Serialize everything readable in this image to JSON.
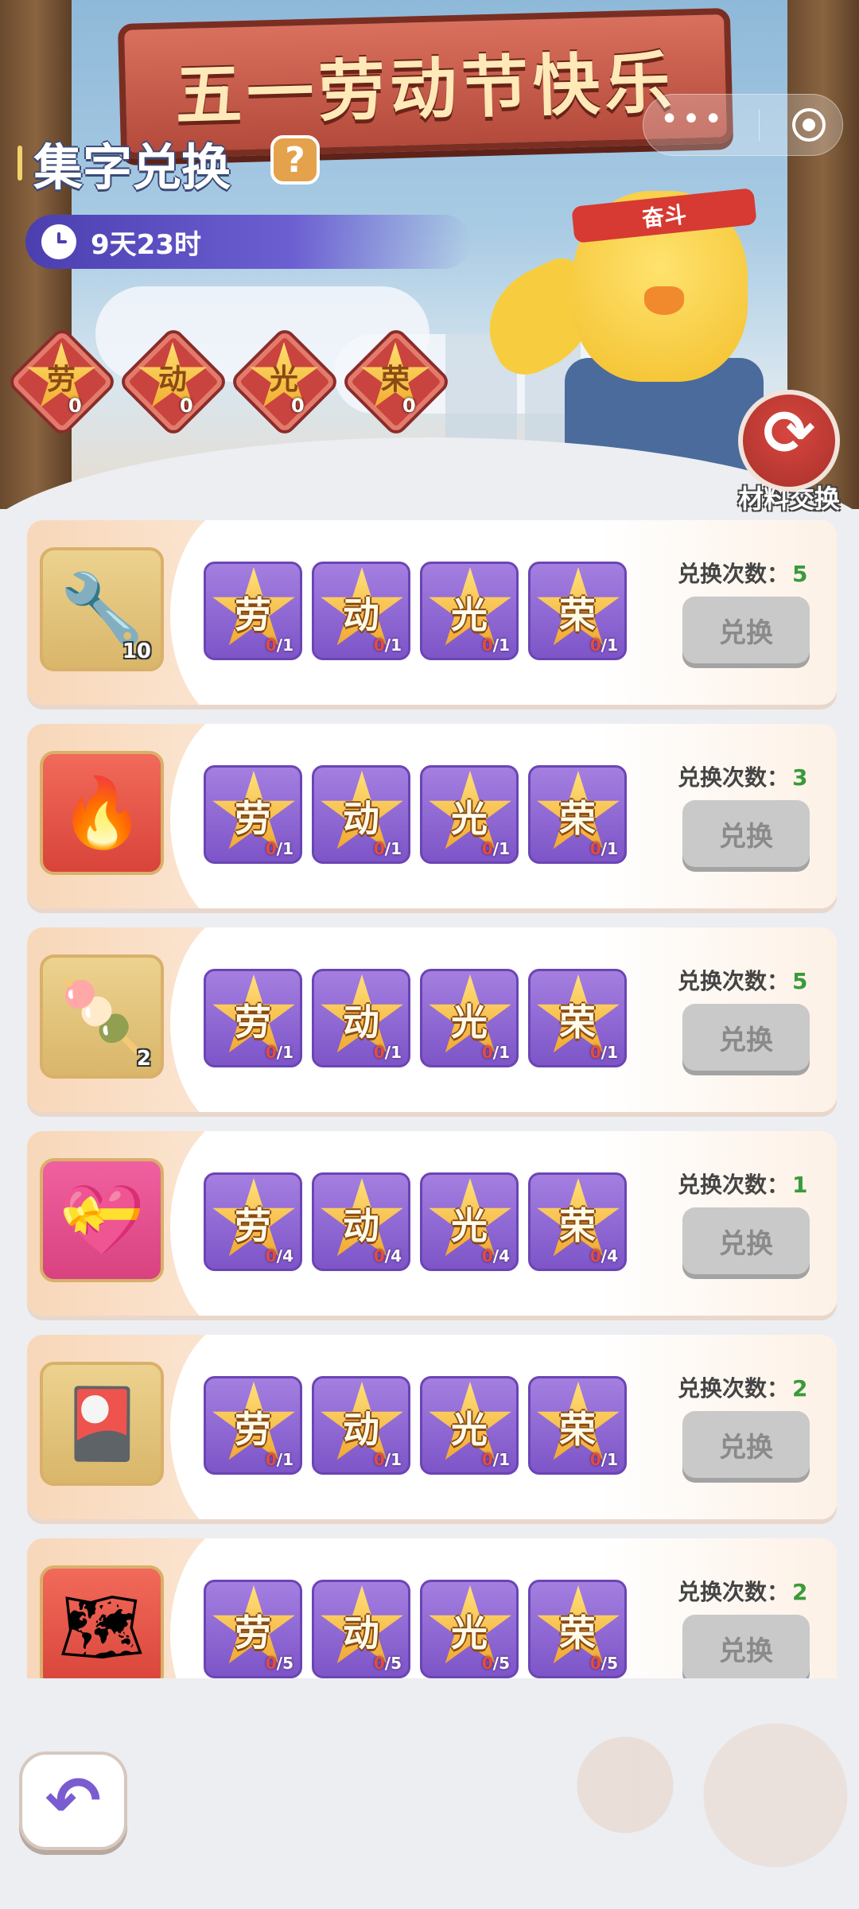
{
  "banner": {
    "sign_text": "五一劳动节快乐",
    "headband_text": "奋斗"
  },
  "header": {
    "title": "集字兑换",
    "help_label": "?",
    "timer": "9天23时",
    "material_exchange_label": "材料交换"
  },
  "collected_chars": [
    {
      "char": "劳",
      "count": "0"
    },
    {
      "char": "动",
      "count": "0"
    },
    {
      "char": "光",
      "count": "0"
    },
    {
      "char": "荣",
      "count": "0"
    }
  ],
  "exchange_items": [
    {
      "reward_icon": "wrench-icon",
      "reward_glyph": "🔧",
      "reward_qty": "10",
      "costs": [
        {
          "char": "劳",
          "have": "0",
          "need": "1"
        },
        {
          "char": "动",
          "have": "0",
          "need": "1"
        },
        {
          "char": "光",
          "have": "0",
          "need": "1"
        },
        {
          "char": "荣",
          "have": "0",
          "need": "1"
        }
      ],
      "times_label": "兑换次数：",
      "times": "5",
      "button": "兑换"
    },
    {
      "reward_icon": "fireball-icon",
      "reward_glyph": "🔥",
      "reward_qty": "",
      "costs": [
        {
          "char": "劳",
          "have": "0",
          "need": "1"
        },
        {
          "char": "动",
          "have": "0",
          "need": "1"
        },
        {
          "char": "光",
          "have": "0",
          "need": "1"
        },
        {
          "char": "荣",
          "have": "0",
          "need": "1"
        }
      ],
      "times_label": "兑换次数：",
      "times": "3",
      "button": "兑换"
    },
    {
      "reward_icon": "popsicle-icon",
      "reward_glyph": "🍡",
      "reward_qty": "2",
      "costs": [
        {
          "char": "劳",
          "have": "0",
          "need": "1"
        },
        {
          "char": "动",
          "have": "0",
          "need": "1"
        },
        {
          "char": "光",
          "have": "0",
          "need": "1"
        },
        {
          "char": "荣",
          "have": "0",
          "need": "1"
        }
      ],
      "times_label": "兑换次数：",
      "times": "5",
      "button": "兑换"
    },
    {
      "reward_icon": "heart-gift-icon",
      "reward_glyph": "💝",
      "reward_qty": "",
      "costs": [
        {
          "char": "劳",
          "have": "0",
          "need": "4"
        },
        {
          "char": "动",
          "have": "0",
          "need": "4"
        },
        {
          "char": "光",
          "have": "0",
          "need": "4"
        },
        {
          "char": "荣",
          "have": "0",
          "need": "4"
        }
      ],
      "times_label": "兑换次数：",
      "times": "1",
      "button": "兑换"
    },
    {
      "reward_icon": "card-pack-icon",
      "reward_glyph": "🎴",
      "reward_qty": "",
      "costs": [
        {
          "char": "劳",
          "have": "0",
          "need": "1"
        },
        {
          "char": "动",
          "have": "0",
          "need": "1"
        },
        {
          "char": "光",
          "have": "0",
          "need": "1"
        },
        {
          "char": "荣",
          "have": "0",
          "need": "1"
        }
      ],
      "times_label": "兑换次数：",
      "times": "2",
      "button": "兑换"
    },
    {
      "reward_icon": "map-icon",
      "reward_glyph": "🗺",
      "reward_qty": "",
      "costs": [
        {
          "char": "劳",
          "have": "0",
          "need": "5"
        },
        {
          "char": "动",
          "have": "0",
          "need": "5"
        },
        {
          "char": "光",
          "have": "0",
          "need": "5"
        },
        {
          "char": "荣",
          "have": "0",
          "need": "5"
        }
      ],
      "times_label": "兑换次数：",
      "times": "2",
      "button": "兑换"
    }
  ],
  "colors": {
    "accent_purple": "#7d55c8",
    "count_green": "#3a9a3a",
    "have_red": "#e64c3c",
    "button_disabled": "#c9c9c9"
  }
}
